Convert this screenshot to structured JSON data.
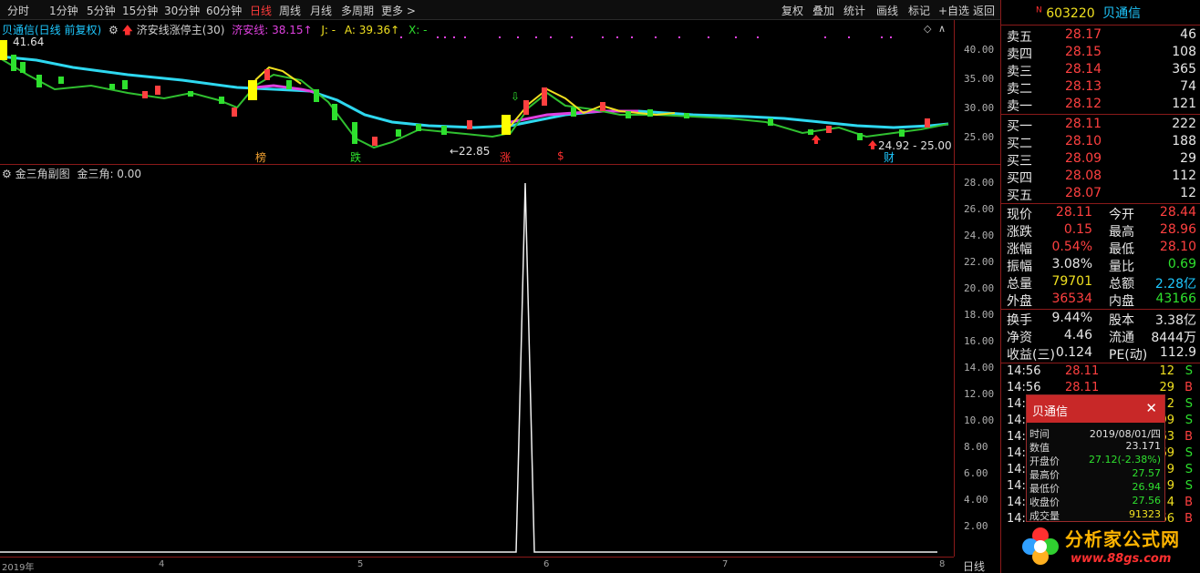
{
  "toolbar": {
    "periods": [
      "分时",
      "1分钟",
      "5分钟",
      "15分钟",
      "30分钟",
      "60分钟",
      "日线",
      "周线",
      "月线",
      "多周期",
      "更多"
    ],
    "active_period": "日线",
    "more_arrow": ">",
    "actions": [
      "复权",
      "叠加",
      "统计",
      "画线",
      "标记",
      "+自选",
      "返回"
    ]
  },
  "main_chart": {
    "title": "贝通信(日线 前复权)",
    "indicator_name": "济安线涨停主(30)",
    "line_label": "济安线: 38.15↑",
    "j_label": "J: -",
    "a_label": "A: 39.36↑",
    "x_label": "X: -",
    "high_label": "41.64",
    "low_label": "←22.85",
    "range_label": "24.92 - 25.00",
    "markers": [
      "榜",
      "跌",
      "涨",
      "$",
      "财"
    ],
    "axis_ticks": [
      "40.00",
      "35.00",
      "30.00",
      "25.00"
    ]
  },
  "sub_chart": {
    "title": "金三角副图",
    "value_label": "金三角: 0.00",
    "axis_ticks": [
      "28.00",
      "26.00",
      "24.00",
      "22.00",
      "20.00",
      "18.00",
      "16.00",
      "14.00",
      "12.00",
      "10.00",
      "8.00",
      "6.00",
      "4.00",
      "2.00"
    ]
  },
  "date_axis": {
    "labels": [
      "2019年",
      "4",
      "5",
      "6",
      "7",
      "8"
    ],
    "corner": "日线"
  },
  "quote": {
    "badge": "N",
    "code": "603220",
    "name": "贝通信",
    "asks": [
      {
        "label": "卖五",
        "price": "28.17",
        "vol": "46"
      },
      {
        "label": "卖四",
        "price": "28.15",
        "vol": "108"
      },
      {
        "label": "卖三",
        "price": "28.14",
        "vol": "365"
      },
      {
        "label": "卖二",
        "price": "28.13",
        "vol": "74"
      },
      {
        "label": "卖一",
        "price": "28.12",
        "vol": "121"
      }
    ],
    "bids": [
      {
        "label": "买一",
        "price": "28.11",
        "vol": "222"
      },
      {
        "label": "买二",
        "price": "28.10",
        "vol": "188"
      },
      {
        "label": "买三",
        "price": "28.09",
        "vol": "29"
      },
      {
        "label": "买四",
        "price": "28.08",
        "vol": "112"
      },
      {
        "label": "买五",
        "price": "28.07",
        "vol": "12"
      }
    ],
    "stats": [
      {
        "l1": "现价",
        "v1": "28.11",
        "l2": "今开",
        "v2": "28.44"
      },
      {
        "l1": "涨跌",
        "v1": "0.15",
        "l2": "最高",
        "v2": "28.96"
      },
      {
        "l1": "涨幅",
        "v1": "0.54%",
        "l2": "最低",
        "v2": "28.10"
      },
      {
        "l1": "振幅",
        "v1": "3.08%",
        "l2": "量比",
        "v2": "0.69"
      },
      {
        "l1": "总量",
        "v1": "79701",
        "l2": "总额",
        "v2": "2.28亿"
      },
      {
        "l1": "外盘",
        "v1": "36534",
        "l2": "内盘",
        "v2": "43166"
      }
    ],
    "stats2": [
      {
        "l1": "换手",
        "v1": "9.44%",
        "l2": "股本",
        "v2": "3.38亿"
      },
      {
        "l1": "净资",
        "v1": "4.46",
        "l2": "流通",
        "v2": "8444万"
      },
      {
        "l1": "收益(三)",
        "v1": "0.124",
        "l2": "PE(动)",
        "v2": "112.9"
      }
    ],
    "ticks": [
      {
        "time": "14:56",
        "price": "28.11",
        "vol": "12",
        "bs": "S"
      },
      {
        "time": "14:56",
        "price": "28.11",
        "vol": "29",
        "bs": "B"
      },
      {
        "time": "14:",
        "price": "",
        "vol": "2",
        "bs": "S"
      },
      {
        "time": "14:",
        "price": "",
        "vol": "99",
        "bs": "S"
      },
      {
        "time": "14:",
        "price": "",
        "vol": "63",
        "bs": "B"
      },
      {
        "time": "14:",
        "price": "",
        "vol": "69",
        "bs": "S"
      },
      {
        "time": "14:",
        "price": "",
        "vol": "9",
        "bs": "S"
      },
      {
        "time": "14:",
        "price": "",
        "vol": "9",
        "bs": "S"
      },
      {
        "time": "14:",
        "price": "",
        "vol": "4",
        "bs": "B"
      },
      {
        "time": "14:",
        "price": "",
        "vol": "66",
        "bs": "B"
      }
    ]
  },
  "popup": {
    "title": "贝通信",
    "close": "✕",
    "rows": [
      {
        "label": "时间",
        "value": "2019/08/01/四"
      },
      {
        "label": "数值",
        "value": "23.171"
      },
      {
        "label": "开盘价",
        "value": "27.12(-2.38%)"
      },
      {
        "label": "最高价",
        "value": "27.57"
      },
      {
        "label": "最低价",
        "value": "26.94"
      },
      {
        "label": "收盘价",
        "value": "27.56"
      },
      {
        "label": "成交量",
        "value": "91323"
      }
    ]
  },
  "watermark": {
    "brand": "分析家公式网",
    "url": "www.88gs.com"
  },
  "colors": {
    "up": "#ff4040",
    "down": "#2ee02e",
    "cyan_line": "#2ed8f0",
    "magenta_line": "#e040e0",
    "yellow_line": "#f0e020",
    "green_line": "#30c030"
  }
}
